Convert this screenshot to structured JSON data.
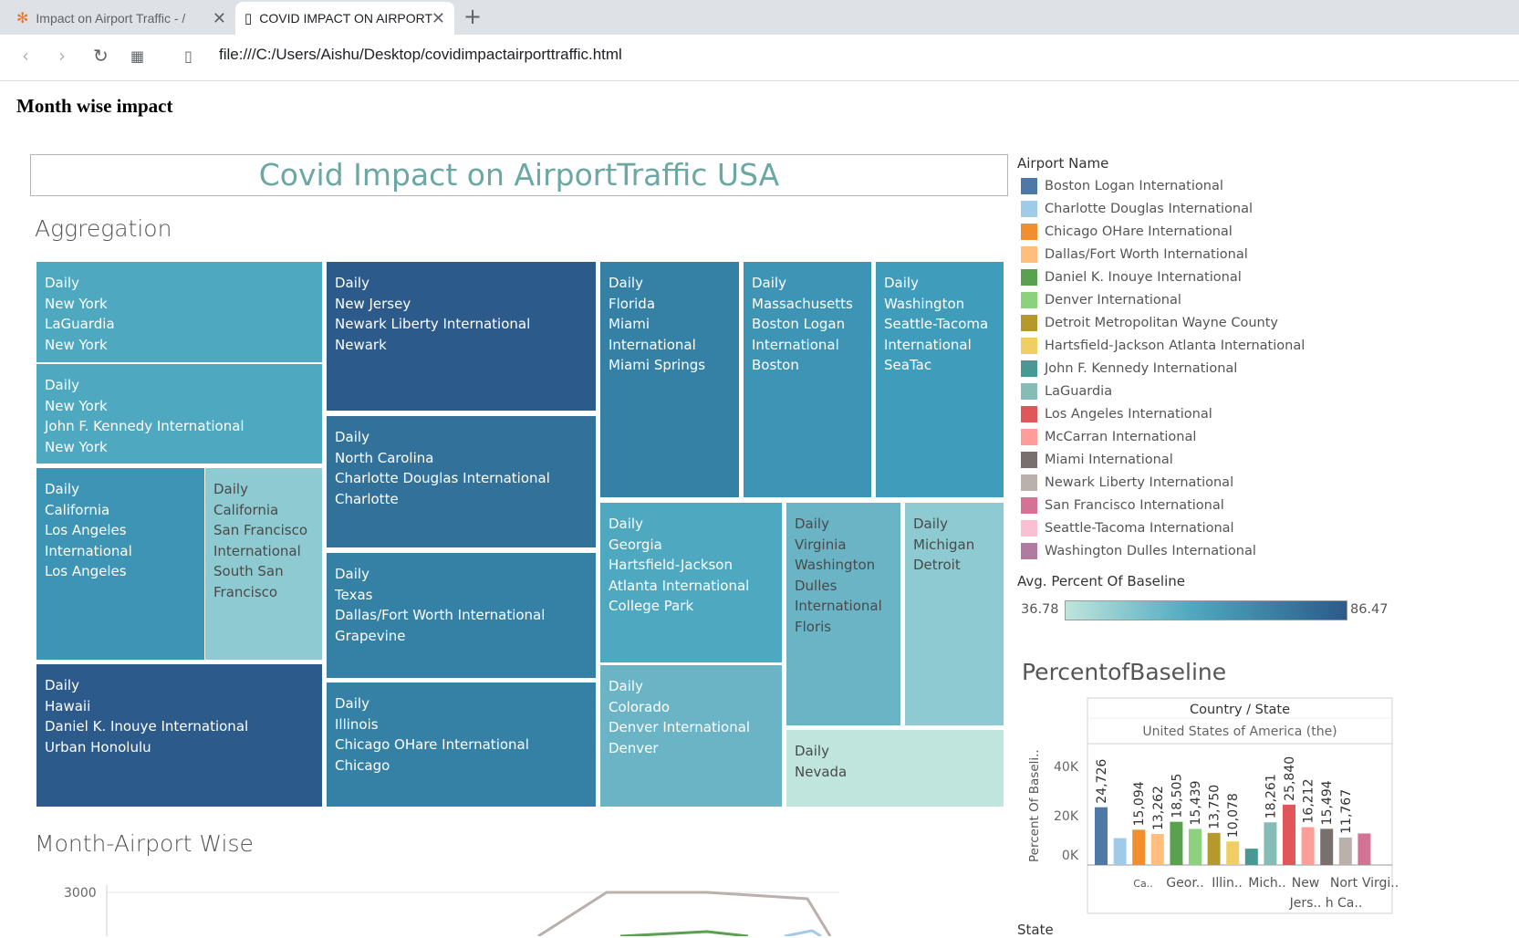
{
  "browser": {
    "tabs": [
      {
        "title": "Impact on Airport Traffic - /",
        "active": false
      },
      {
        "title": "COVID IMPACT ON AIRPORT",
        "active": true
      }
    ],
    "url": "file:///C:/Users/Aishu/Desktop/covidimpactairporttraffic.html"
  },
  "page": {
    "heading": "Month wise impact",
    "dashboard_title": "Covid Impact on AirportTraffic USA",
    "aggregation_title": "Aggregation",
    "month_airport_title": "Month-Airport Wise",
    "month_axis_tick": "3000",
    "percent_title": "PercentofBaseline",
    "state_label": "State"
  },
  "treemap": [
    {
      "lines": [
        "Daily",
        "New York",
        "LaGuardia",
        "New York"
      ],
      "color": "#4ea8c0"
    },
    {
      "lines": [
        "Daily",
        "New York",
        "John F. Kennedy International",
        "New York"
      ],
      "color": "#4ea8c0"
    },
    {
      "lines": [
        "Daily",
        "California",
        "Los Angeles",
        "International",
        "Los Angeles"
      ],
      "color": "#3d94b4"
    },
    {
      "lines": [
        "Daily",
        "California",
        "San Francisco",
        "International",
        "South San",
        "Francisco"
      ],
      "color": "#8ecad1"
    },
    {
      "lines": [
        "Daily",
        "Hawaii",
        "Daniel K. Inouye International",
        "Urban Honolulu"
      ],
      "color": "#2c5a8a"
    },
    {
      "lines": [
        "Daily",
        "New Jersey",
        "Newark Liberty International",
        "Newark"
      ],
      "color": "#2c5a8a"
    },
    {
      "lines": [
        "Daily",
        "North Carolina",
        "Charlotte Douglas International",
        "Charlotte"
      ],
      "color": "#32719a"
    },
    {
      "lines": [
        "Daily",
        "Texas",
        "Dallas/Fort Worth International",
        "Grapevine"
      ],
      "color": "#3581a6"
    },
    {
      "lines": [
        "Daily",
        "Illinois",
        "Chicago OHare International",
        "Chicago"
      ],
      "color": "#3581a6"
    },
    {
      "lines": [
        "Daily",
        "Florida",
        "Miami",
        "International",
        "Miami Springs"
      ],
      "color": "#3581a6"
    },
    {
      "lines": [
        "Daily",
        "Massachusetts",
        "Boston Logan",
        "International",
        "Boston"
      ],
      "color": "#3d94b4"
    },
    {
      "lines": [
        "Daily",
        "Washington",
        "Seattle-Tacoma",
        "International",
        "SeaTac"
      ],
      "color": "#409cbb"
    },
    {
      "lines": [
        "Daily",
        "Georgia",
        "Hartsfield-Jackson",
        "Atlanta International",
        "College Park"
      ],
      "color": "#4ea8c0"
    },
    {
      "lines": [
        "Daily",
        "Colorado",
        "Denver International",
        "Denver"
      ],
      "color": "#6ab4c6"
    },
    {
      "lines": [
        "Daily",
        "Virginia",
        "Washington",
        "Dulles",
        "International",
        "Floris"
      ],
      "color": "#6ab4c6"
    },
    {
      "lines": [
        "Daily",
        "Michigan",
        "Detroit"
      ],
      "color": "#8ecad1"
    },
    {
      "lines": [
        "Daily",
        "Nevada"
      ],
      "color": "#bfe5dc"
    }
  ],
  "legend": {
    "title": "Airport Name",
    "items": [
      {
        "label": "Boston Logan International",
        "color": "#4e79a7"
      },
      {
        "label": "Charlotte Douglas International",
        "color": "#a0cbe8"
      },
      {
        "label": "Chicago OHare International",
        "color": "#f28e2b"
      },
      {
        "label": "Dallas/Fort Worth International",
        "color": "#ffbe7d"
      },
      {
        "label": "Daniel K. Inouye International",
        "color": "#59a14f"
      },
      {
        "label": "Denver International",
        "color": "#8cd17d"
      },
      {
        "label": "Detroit Metropolitan Wayne County",
        "color": "#b6992d"
      },
      {
        "label": "Hartsfield-Jackson Atlanta International",
        "color": "#f1ce63"
      },
      {
        "label": "John F. Kennedy International",
        "color": "#499894"
      },
      {
        "label": "LaGuardia",
        "color": "#86bcb6"
      },
      {
        "label": "Los Angeles International",
        "color": "#e15759"
      },
      {
        "label": "McCarran International",
        "color": "#ff9d9a"
      },
      {
        "label": "Miami International",
        "color": "#79706e"
      },
      {
        "label": "Newark Liberty International",
        "color": "#bab0ac"
      },
      {
        "label": "San Francisco International",
        "color": "#d37295"
      },
      {
        "label": "Seattle-Tacoma International",
        "color": "#fabfd2"
      },
      {
        "label": "Washington Dulles International",
        "color": "#b07aa1"
      }
    ],
    "gradient_title": "Avg. Percent Of Baseline",
    "gradient_min": "36.78",
    "gradient_max": "86.47"
  },
  "chart_data": {
    "type": "bar",
    "header": "Country / State",
    "subheader": "United States of America (the)",
    "ylabel": "Percent Of Baseli..",
    "yticks": [
      "40K",
      "20K",
      "0K"
    ],
    "ylim": [
      0,
      50000
    ],
    "bars": [
      {
        "airport": "Boston Logan International",
        "value": 24726,
        "label": "24,726",
        "color": "#4e79a7"
      },
      {
        "airport": "Charlotte Douglas International",
        "value": 11500,
        "label": "",
        "color": "#a0cbe8"
      },
      {
        "airport": "Chicago OHare International",
        "value": 15094,
        "label": "15,094",
        "color": "#f28e2b"
      },
      {
        "airport": "Dallas/Fort Worth International",
        "value": 13262,
        "label": "13,262",
        "color": "#ffbe7d"
      },
      {
        "airport": "Daniel K. Inouye International",
        "value": 18505,
        "label": "18,505",
        "color": "#59a14f"
      },
      {
        "airport": "Denver International",
        "value": 15439,
        "label": "15,439",
        "color": "#8cd17d"
      },
      {
        "airport": "Detroit Metropolitan Wayne County",
        "value": 13750,
        "label": "13,750",
        "color": "#b6992d"
      },
      {
        "airport": "Hartsfield-Jackson Atlanta International",
        "value": 10078,
        "label": "10,078",
        "color": "#f1ce63"
      },
      {
        "airport": "John F. Kennedy International",
        "value": 7000,
        "label": "",
        "color": "#499894"
      },
      {
        "airport": "LaGuardia",
        "value": 18261,
        "label": "18,261",
        "color": "#86bcb6"
      },
      {
        "airport": "Los Angeles International",
        "value": 25840,
        "label": "25,840",
        "color": "#e15759"
      },
      {
        "airport": "McCarran International",
        "value": 16212,
        "label": "16,212",
        "color": "#ff9d9a"
      },
      {
        "airport": "Miami International",
        "value": 15494,
        "label": "15,494",
        "color": "#79706e"
      },
      {
        "airport": "Newark Liberty International",
        "value": 11767,
        "label": "11,767",
        "color": "#bab0ac"
      },
      {
        "airport": "San Francisco International",
        "value": 13500,
        "label": "",
        "color": "#d37295"
      }
    ],
    "state_labels": [
      "Ca..",
      "Geor..",
      "Illin..",
      "Mich..",
      "New Jers..",
      "Nort h Ca..",
      "Virgi.."
    ]
  }
}
